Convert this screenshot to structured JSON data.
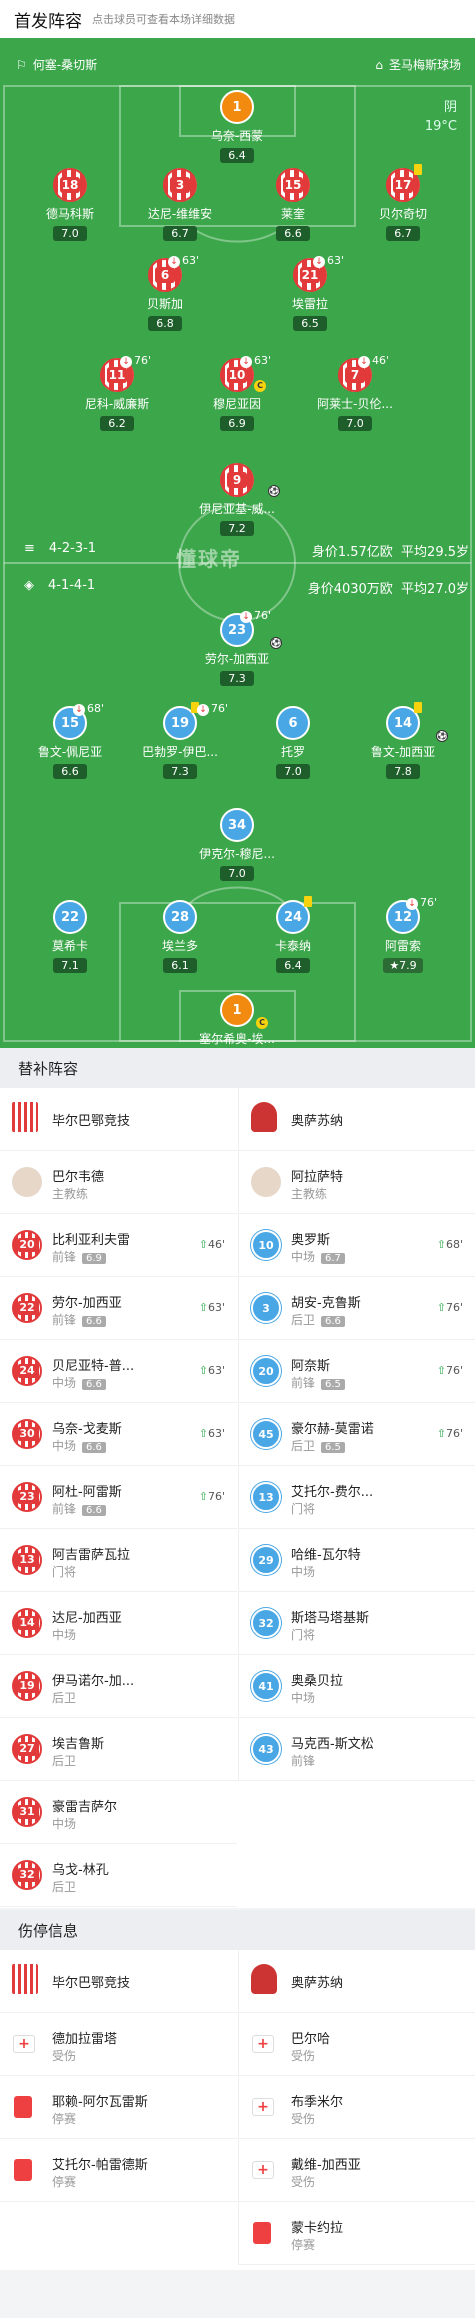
{
  "header": {
    "title": "首发阵容",
    "subtitle": "点击球员可查看本场详细数据"
  },
  "pitch": {
    "top_team": "何塞-桑切斯",
    "bottom_team": "圣马梅斯球场",
    "weather": "阴",
    "temperature": "19°C",
    "watermark": "懂球帝",
    "home_formation": "4-2-3-1",
    "home_value": "身价1.57亿欧",
    "home_age": "平均29.5岁",
    "away_formation": "4-1-4-1",
    "away_value": "身价4030万欧",
    "away_age": "平均27.0岁"
  },
  "players": [
    {
      "num": "1",
      "name": "乌奈-西蒙",
      "rating": "6.4",
      "kit": "gk"
    },
    {
      "num": "18",
      "name": "德马科斯",
      "rating": "7.0",
      "kit": "stripe"
    },
    {
      "num": "3",
      "name": "达尼-维维安",
      "rating": "6.7",
      "kit": "stripe"
    },
    {
      "num": "15",
      "name": "莱奎",
      "rating": "6.6",
      "kit": "stripe"
    },
    {
      "num": "17",
      "name": "贝尔奇切",
      "rating": "6.7",
      "kit": "stripe",
      "yellow": true
    },
    {
      "num": "6",
      "name": "贝斯加",
      "rating": "6.8",
      "kit": "stripe",
      "sub": "63'"
    },
    {
      "num": "21",
      "name": "埃雷拉",
      "rating": "6.5",
      "kit": "stripe",
      "sub": "63'"
    },
    {
      "num": "11",
      "name": "尼科-威廉斯",
      "rating": "6.2",
      "kit": "stripe",
      "sub": "76'"
    },
    {
      "num": "10",
      "name": "穆尼亚因",
      "rating": "6.9",
      "kit": "stripe",
      "sub": "63'",
      "captain": true
    },
    {
      "num": "7",
      "name": "阿莱士-贝伦...",
      "rating": "7.0",
      "kit": "stripe",
      "sub": "46'"
    },
    {
      "num": "9",
      "name": "伊尼亚基-威...",
      "rating": "7.2",
      "kit": "stripe",
      "ball": true
    },
    {
      "num": "23",
      "name": "劳尔-加西亚",
      "rating": "7.3",
      "kit": "blue",
      "sub": "76'",
      "ball": true
    },
    {
      "num": "15",
      "name": "鲁文-佩尼亚",
      "rating": "6.6",
      "kit": "blue",
      "sub": "68'"
    },
    {
      "num": "19",
      "name": "巴勃罗-伊巴...",
      "rating": "7.3",
      "kit": "blue",
      "sub": "76'",
      "yellow": true
    },
    {
      "num": "6",
      "name": "托罗",
      "rating": "7.0",
      "kit": "blue"
    },
    {
      "num": "14",
      "name": "鲁文-加西亚",
      "rating": "7.8",
      "kit": "blue",
      "yellow": true,
      "ball": true
    },
    {
      "num": "34",
      "name": "伊克尔-穆尼...",
      "rating": "7.0",
      "kit": "blue"
    },
    {
      "num": "22",
      "name": "莫希卡",
      "rating": "7.1",
      "kit": "blue"
    },
    {
      "num": "28",
      "name": "埃兰多",
      "rating": "6.1",
      "kit": "blue"
    },
    {
      "num": "24",
      "name": "卡泰纳",
      "rating": "6.4",
      "kit": "blue",
      "yellow": true
    },
    {
      "num": "12",
      "name": "阿雷索",
      "rating": "7.9",
      "kit": "blue",
      "sub": "76'",
      "star": true
    },
    {
      "num": "1",
      "name": "塞尔希奥-埃...",
      "rating": "7.0",
      "kit": "gk",
      "captain": true
    }
  ],
  "subs": {
    "title": "替补阵容",
    "home_team": "毕尔巴鄂竞技",
    "away_team": "奥萨苏纳",
    "home_coach": {
      "name": "巴尔韦德",
      "role": "主教练"
    },
    "away_coach": {
      "name": "阿拉萨特",
      "role": "主教练"
    },
    "home": [
      {
        "num": "20",
        "name": "比利亚利夫雷",
        "pos": "前锋",
        "rating": "6.9",
        "in": "46'"
      },
      {
        "num": "22",
        "name": "劳尔-加西亚",
        "pos": "前锋",
        "rating": "6.6",
        "in": "63'"
      },
      {
        "num": "24",
        "name": "贝尼亚特-普...",
        "pos": "中场",
        "rating": "6.6",
        "in": "63'"
      },
      {
        "num": "30",
        "name": "乌奈-戈麦斯",
        "pos": "中场",
        "rating": "6.6",
        "in": "63'"
      },
      {
        "num": "23",
        "name": "阿杜-阿雷斯",
        "pos": "前锋",
        "rating": "6.6",
        "in": "76'"
      },
      {
        "num": "13",
        "name": "阿吉雷萨瓦拉",
        "pos": "门将"
      },
      {
        "num": "14",
        "name": "达尼-加西亚",
        "pos": "中场"
      },
      {
        "num": "19",
        "name": "伊马诺尔-加...",
        "pos": "后卫"
      },
      {
        "num": "27",
        "name": "埃吉鲁斯",
        "pos": "后卫"
      },
      {
        "num": "31",
        "name": "豪雷吉萨尔",
        "pos": "中场"
      },
      {
        "num": "32",
        "name": "乌戈-林孔",
        "pos": "后卫"
      }
    ],
    "away": [
      {
        "num": "10",
        "name": "奥罗斯",
        "pos": "中场",
        "rating": "6.7",
        "in": "68'"
      },
      {
        "num": "3",
        "name": "胡安-克鲁斯",
        "pos": "后卫",
        "rating": "6.6",
        "in": "76'"
      },
      {
        "num": "20",
        "name": "阿奈斯",
        "pos": "前锋",
        "rating": "6.5",
        "in": "76'"
      },
      {
        "num": "45",
        "name": "豪尔赫-莫雷诺",
        "pos": "后卫",
        "rating": "6.5",
        "in": "76'"
      },
      {
        "num": "13",
        "name": "艾托尔-费尔...",
        "pos": "门将"
      },
      {
        "num": "29",
        "name": "哈维-瓦尔特",
        "pos": "中场"
      },
      {
        "num": "32",
        "name": "斯塔马塔基斯",
        "pos": "门将"
      },
      {
        "num": "41",
        "name": "奥桑贝拉",
        "pos": "中场"
      },
      {
        "num": "43",
        "name": "马克西-斯文松",
        "pos": "前锋"
      }
    ]
  },
  "injuries": {
    "title": "伤停信息",
    "home_team": "毕尔巴鄂竞技",
    "away_team": "奥萨苏纳",
    "home": [
      {
        "name": "德加拉雷塔",
        "status": "受伤",
        "type": "injury"
      },
      {
        "name": "耶赖-阿尔瓦雷斯",
        "status": "停赛",
        "type": "suspension"
      },
      {
        "name": "艾托尔-帕雷德斯",
        "status": "停赛",
        "type": "suspension"
      }
    ],
    "away": [
      {
        "name": "巴尔哈",
        "status": "受伤",
        "type": "injury"
      },
      {
        "name": "布季米尔",
        "status": "受伤",
        "type": "injury"
      },
      {
        "name": "戴维-加西亚",
        "status": "受伤",
        "type": "injury"
      },
      {
        "name": "蒙卡约拉",
        "status": "停赛",
        "type": "suspension"
      }
    ]
  }
}
